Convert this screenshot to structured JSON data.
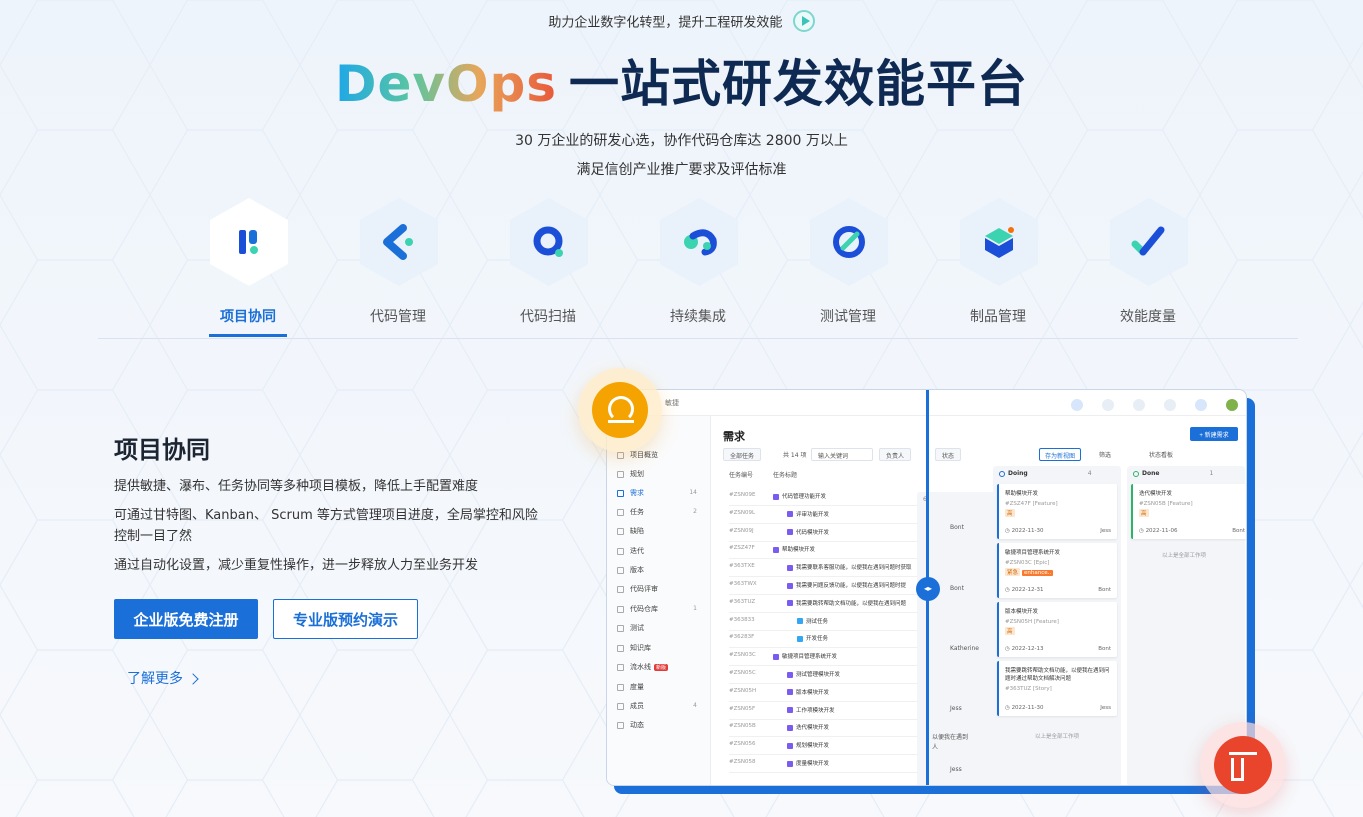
{
  "hero": {
    "tagline": "助力企业数字化转型，提升工程研发效能",
    "title_gradient": "DevOps",
    "title_main": "一站式研发效能平台",
    "subtitle_1": "30 万企业的研发心选，协作代码仓库达 2800 万以上",
    "subtitle_2": "满足信创产业推广要求及评估标准"
  },
  "products": [
    {
      "label": "项目协同",
      "icon": "project-collab-icon",
      "active": true
    },
    {
      "label": "代码管理",
      "icon": "code-manage-icon"
    },
    {
      "label": "代码扫描",
      "icon": "code-scan-icon"
    },
    {
      "label": "持续集成",
      "icon": "ci-icon"
    },
    {
      "label": "测试管理",
      "icon": "test-manage-icon"
    },
    {
      "label": "制品管理",
      "icon": "artifact-icon"
    },
    {
      "label": "效能度量",
      "icon": "metrics-icon"
    }
  ],
  "section": {
    "title": "项目协同",
    "p1": "提供敏捷、瀑布、任务协同等多种项目模板，降低上手配置难度",
    "p2": "可通过甘特图、Kanban、 Scrum 等方式管理项目进度，全局掌控和风险控制一目了然",
    "p3": "通过自动化设置，减少重复性操作，进一步释放人力至业务开发",
    "btn_primary": "企业版免费注册",
    "btn_secondary": "专业版预约演示",
    "more": "了解更多"
  },
  "mock": {
    "crumb": "敏捷",
    "sidebar": [
      {
        "label": "项目概览"
      },
      {
        "label": "规划"
      },
      {
        "label": "需求",
        "count": "14",
        "active": true
      },
      {
        "label": "任务",
        "count": "2"
      },
      {
        "label": "缺陷"
      },
      {
        "label": "迭代"
      },
      {
        "label": "版本"
      },
      {
        "label": "代码评审"
      },
      {
        "label": "代码仓库",
        "count": "1"
      },
      {
        "label": "测试"
      },
      {
        "label": "知识库"
      },
      {
        "label": "流水线",
        "tag": "新版"
      },
      {
        "label": "度量"
      },
      {
        "label": "成员",
        "count": "4"
      },
      {
        "label": "动态"
      }
    ],
    "title": "需求",
    "new_btn": "+ 新建需求",
    "filters": {
      "all": "全部任务",
      "total": "共 14 项",
      "search": "输入关键词",
      "owner": "负责人",
      "status": "状态",
      "save_view": "存为新视图",
      "filter": "筛选",
      "board": "状态看板"
    },
    "table_head": {
      "id": "任务编号",
      "title": "任务标题"
    },
    "rows": [
      {
        "id": "#ZSN09E",
        "title": "代码管理功能开发",
        "type": "epic"
      },
      {
        "id": "#ZSN09L",
        "title": "评审功能开发",
        "type": "sub"
      },
      {
        "id": "#ZSN09J",
        "title": "代码模块开发",
        "type": "sub"
      },
      {
        "id": "#ZSZ47F",
        "title": "帮助模块开发",
        "type": "epic"
      },
      {
        "id": "#363TXE",
        "title": "我需要联系客服功能，以便我在遇到问题时获取",
        "type": "sub"
      },
      {
        "id": "#363TWX",
        "title": "我需要问题反馈功能，以便我在遇到问题时提",
        "type": "sub"
      },
      {
        "id": "#363TUZ",
        "title": "我需要跳转帮助文档功能，以便我在遇到问题",
        "type": "sub"
      },
      {
        "id": "#363833",
        "title": "测试任务",
        "type": "task"
      },
      {
        "id": "#36283F",
        "title": "开发任务",
        "type": "task"
      },
      {
        "id": "#ZSN03C",
        "title": "敏捷项目管理系统开发",
        "type": "epic"
      },
      {
        "id": "#ZSN05C",
        "title": "测试管理模块开发",
        "type": "sub"
      },
      {
        "id": "#ZSN05H",
        "title": "版本模块开发",
        "type": "sub"
      },
      {
        "id": "#ZSN05F",
        "title": "工作项模块开发",
        "type": "sub"
      },
      {
        "id": "#ZSN05B",
        "title": "迭代模块开发",
        "type": "sub"
      },
      {
        "id": "#ZSN056",
        "title": "规划模块开发",
        "type": "sub"
      },
      {
        "id": "#ZSN058",
        "title": "度量模块开发",
        "type": "sub"
      }
    ],
    "leftover": [
      {
        "text": "Bont"
      },
      {
        "text": "Bont"
      },
      {
        "text": "Katherine"
      },
      {
        "text": "Jess"
      },
      {
        "text": "以便我在遇到"
      },
      {
        "text": "人"
      },
      {
        "text": "Jess"
      }
    ],
    "col_prev_count": "6",
    "doing": {
      "name": "Doing",
      "count": "4",
      "cards": [
        {
          "title": "帮助模块开发",
          "id": "#ZSZ47F",
          "type": "[Feature]",
          "tag": "高",
          "date": "2022-11-30",
          "user": "Jess"
        },
        {
          "title": "敏捷项目管理系统开发",
          "id": "#ZSN03C",
          "type": "[Epic]",
          "tag": "紧急",
          "tag2": "enhance..",
          "date": "2022-12-31",
          "user": "Bont"
        },
        {
          "title": "版本模块开发",
          "id": "#ZSN05H",
          "type": "[Feature]",
          "tag": "高",
          "date": "2022-12-13",
          "user": "Bont"
        },
        {
          "title": "我需要跳转帮助文档功能，以便我在遇到问题时通过帮助文档解决问题",
          "id": "#363TUZ",
          "type": "[Story]",
          "date": "2022-11-30",
          "user": "Jess"
        }
      ],
      "footer": "以上是全部工作项"
    },
    "done": {
      "name": "Done",
      "count": "1",
      "cards": [
        {
          "title": "迭代模块开发",
          "id": "#ZSN05B",
          "type": "[Feature]",
          "tag": "高",
          "date": "2022-11-06",
          "user": "Bont"
        }
      ],
      "footer": "以上是全部工作项"
    }
  },
  "colors": {
    "primary": "#1b6fd8",
    "accent_orange": "#f5a300",
    "accent_red": "#e8452c"
  }
}
